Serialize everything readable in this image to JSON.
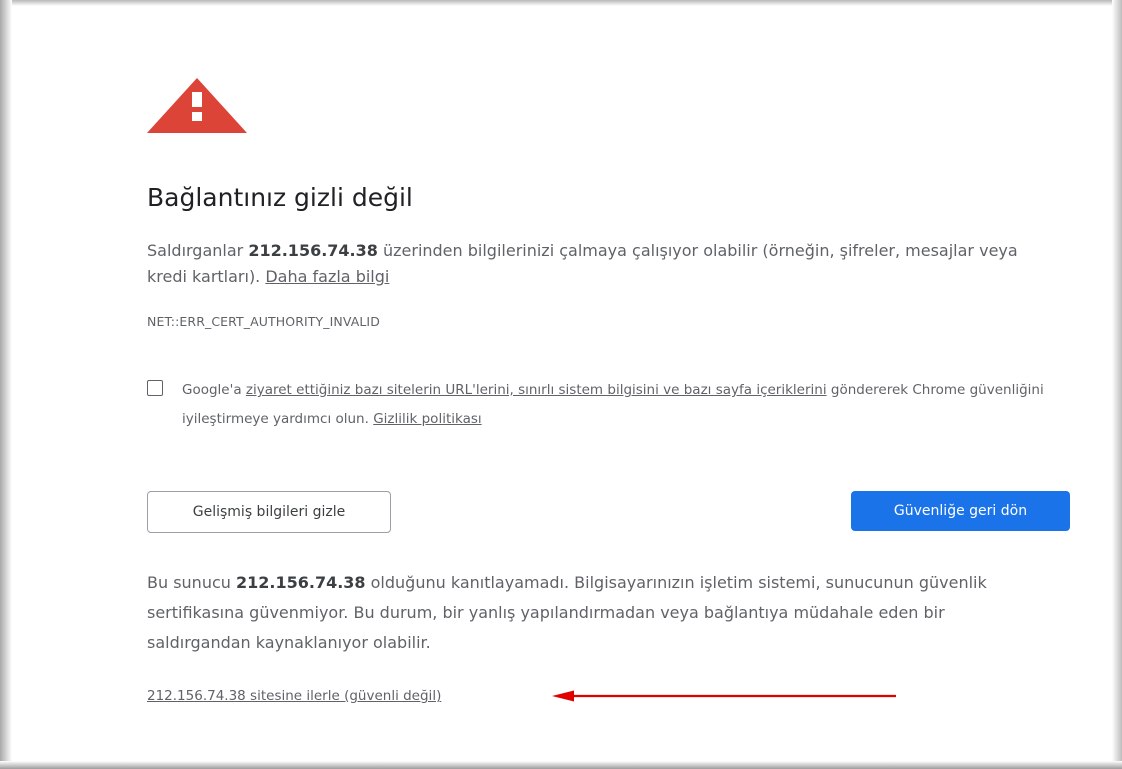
{
  "colors": {
    "warning_red": "#db4437",
    "primary_blue": "#1a73e8",
    "text": "#5f6368",
    "heading": "#202124",
    "annotation_arrow": "#e00000"
  },
  "icons": {
    "warning": "warning-triangle-icon",
    "arrow": "red-arrow-annotation"
  },
  "heading": "Bağlantınız gizli değil",
  "intro": {
    "before": "Saldırganlar ",
    "host": "212.156.74.38",
    "after": " üzerinden bilgilerinizi çalmaya çalışıyor olabilir (örneğin, şifreler, mesajlar veya kredi kartları). ",
    "learn_more_link": "Daha fazla bilgi"
  },
  "error_code": "NET::ERR_CERT_AUTHORITY_INVALID",
  "opt_in": {
    "checked": false,
    "before": "Google'a ",
    "link_text": "ziyaret ettiğiniz bazı sitelerin URL'lerini, sınırlı sistem bilgisini ve bazı sayfa içeriklerini",
    "middle": " göndererek Chrome güvenliğini iyileştirmeye yardımcı olun. ",
    "privacy_link": "Gizlilik politikası"
  },
  "buttons": {
    "hide_advanced": "Gelişmiş bilgileri gizle",
    "back_to_safety": "Güvenliğe geri dön"
  },
  "details": {
    "before": "Bu sunucu ",
    "host": "212.156.74.38",
    "after": " olduğunu kanıtlayamadı. Bilgisayarınızın işletim sistemi, sunucunun güvenlik sertifikasına güvenmiyor. Bu durum, bir yanlış yapılandırmadan veya bağlantıya müdahale eden bir saldırgandan kaynaklanıyor olabilir."
  },
  "proceed_link": "212.156.74.38 sitesine ilerle (güvenli değil)"
}
